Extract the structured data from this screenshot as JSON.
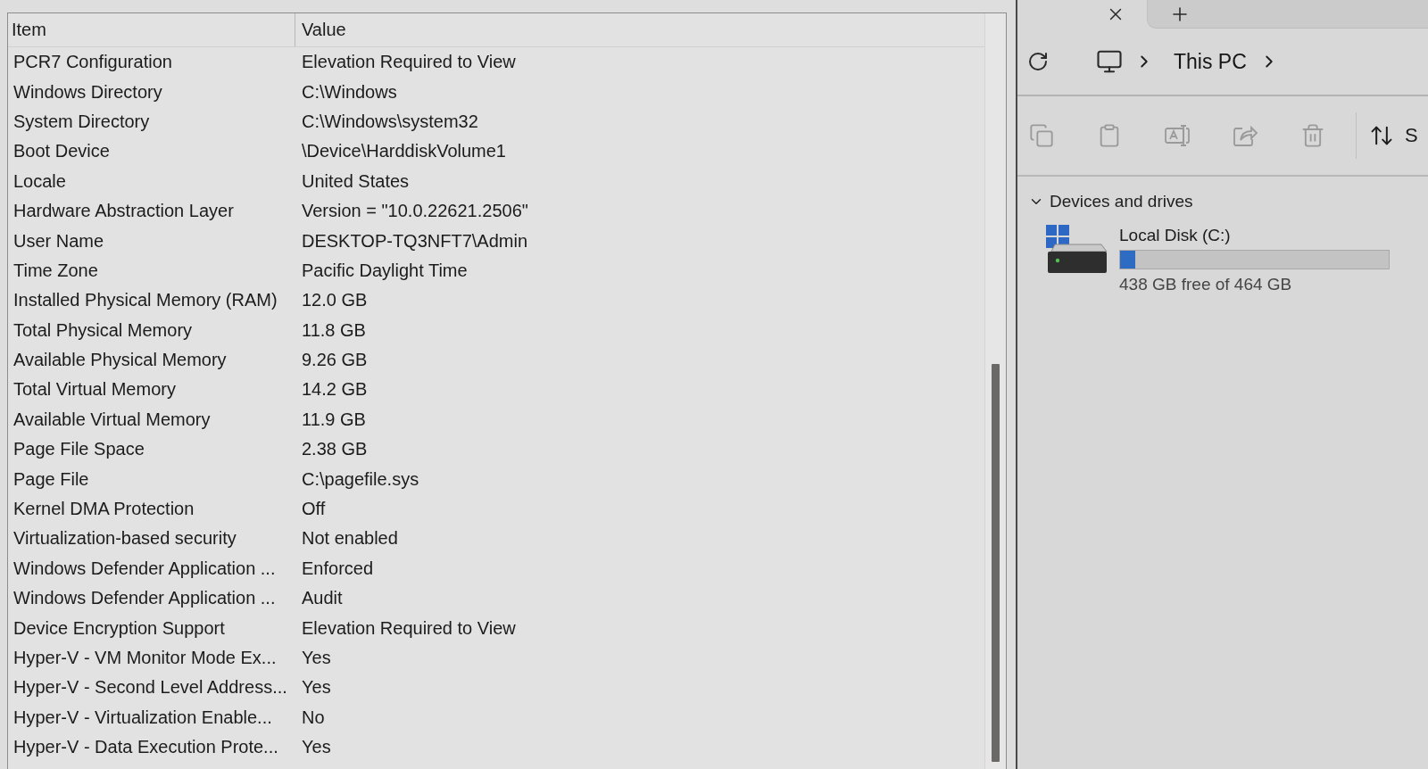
{
  "system_info": {
    "columns": [
      "Item",
      "Value"
    ],
    "rows": [
      {
        "item": "PCR7 Configuration",
        "value": "Elevation Required to View"
      },
      {
        "item": "Windows Directory",
        "value": "C:\\Windows"
      },
      {
        "item": "System Directory",
        "value": "C:\\Windows\\system32"
      },
      {
        "item": "Boot Device",
        "value": "\\Device\\HarddiskVolume1"
      },
      {
        "item": "Locale",
        "value": "United States"
      },
      {
        "item": "Hardware Abstraction Layer",
        "value": "Version = \"10.0.22621.2506\""
      },
      {
        "item": "User Name",
        "value": "DESKTOP-TQ3NFT7\\Admin"
      },
      {
        "item": "Time Zone",
        "value": "Pacific Daylight Time"
      },
      {
        "item": "Installed Physical Memory (RAM)",
        "value": "12.0 GB"
      },
      {
        "item": "Total Physical Memory",
        "value": "11.8 GB"
      },
      {
        "item": "Available Physical Memory",
        "value": "9.26 GB"
      },
      {
        "item": "Total Virtual Memory",
        "value": "14.2 GB"
      },
      {
        "item": "Available Virtual Memory",
        "value": "11.9 GB"
      },
      {
        "item": "Page File Space",
        "value": "2.38 GB"
      },
      {
        "item": "Page File",
        "value": "C:\\pagefile.sys"
      },
      {
        "item": "Kernel DMA Protection",
        "value": "Off"
      },
      {
        "item": "Virtualization-based security",
        "value": "Not enabled"
      },
      {
        "item": "Windows Defender Application ...",
        "value": "Enforced"
      },
      {
        "item": "Windows Defender Application ...",
        "value": "Audit"
      },
      {
        "item": "Device Encryption Support",
        "value": "Elevation Required to View"
      },
      {
        "item": "Hyper-V - VM Monitor Mode Ex...",
        "value": "Yes"
      },
      {
        "item": "Hyper-V - Second Level Address...",
        "value": "Yes"
      },
      {
        "item": "Hyper-V - Virtualization Enable...",
        "value": "No"
      },
      {
        "item": "Hyper-V - Data Execution Prote...",
        "value": "Yes"
      }
    ]
  },
  "explorer": {
    "address_bar": {
      "breadcrumbs": [
        "This PC"
      ]
    },
    "toolbar": {
      "buttons": [
        {
          "kind": "copy",
          "disabled": true
        },
        {
          "kind": "paste",
          "disabled": true
        },
        {
          "kind": "rename",
          "disabled": true
        },
        {
          "kind": "share",
          "disabled": true
        },
        {
          "kind": "delete",
          "disabled": true
        }
      ],
      "sort": {
        "label": "S"
      }
    },
    "sections": [
      {
        "title": "Devices and drives",
        "expanded": true,
        "drives": [
          {
            "name": "Local Disk (C:)",
            "level": 0.056,
            "free_text": "438 GB free of 464 GB"
          }
        ]
      }
    ]
  }
}
